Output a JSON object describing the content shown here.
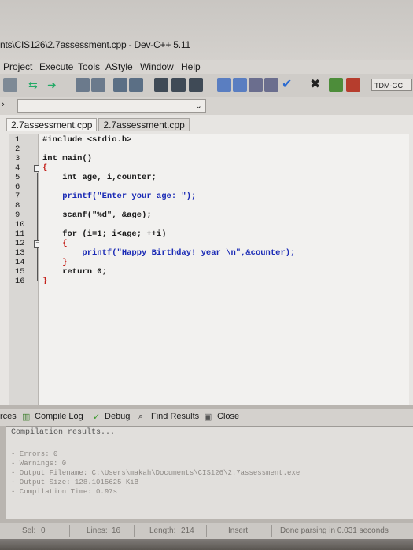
{
  "window": {
    "title": "nts\\CIS126\\2.7assessment.cpp - Dev-C++ 5.11"
  },
  "menubar": {
    "items": [
      "Project",
      "Execute",
      "Tools",
      "AStyle",
      "Window",
      "Help"
    ]
  },
  "toolbar": {
    "compiler_selector": "TDM-GC"
  },
  "editor": {
    "tabs": [
      "2.7assessment.cpp",
      "2.7assessment.cpp"
    ],
    "active_tab": 0,
    "lines": [
      {
        "n": "1",
        "text": "#include <stdio.h>"
      },
      {
        "n": "2",
        "text": ""
      },
      {
        "n": "3",
        "text": "int main()"
      },
      {
        "n": "4",
        "text": "{"
      },
      {
        "n": "5",
        "text": "    int age, i,counter;"
      },
      {
        "n": "6",
        "text": ""
      },
      {
        "n": "7",
        "text": "    printf(\"Enter your age: \");"
      },
      {
        "n": "8",
        "text": ""
      },
      {
        "n": "9",
        "text": "    scanf(\"%d\", &age);"
      },
      {
        "n": "10",
        "text": ""
      },
      {
        "n": "11",
        "text": "    for (i=1; i<age; ++i)"
      },
      {
        "n": "12",
        "text": "    {"
      },
      {
        "n": "13",
        "text": "        printf(\"Happy Birthday! year \\n\",&counter);"
      },
      {
        "n": "14",
        "text": "    }"
      },
      {
        "n": "15",
        "text": "    return 0;"
      },
      {
        "n": "16",
        "text": "}"
      }
    ]
  },
  "bottom_panel": {
    "tabs": [
      "rces",
      "Compile Log",
      "Debug",
      "Find Results",
      "Close"
    ],
    "results_header": "Compilation results...",
    "results": [
      "- Errors: 0",
      "- Warnings: 0",
      "- Output Filename: C:\\Users\\makah\\Documents\\CIS126\\2.7assessment.exe",
      "- Output Size: 128.1015625 KiB",
      "- Compilation Time: 0.97s"
    ]
  },
  "statusbar": {
    "sel_label": "Sel:",
    "sel_value": "0",
    "lines_label": "Lines:",
    "lines_value": "16",
    "length_label": "Length:",
    "length_value": "214",
    "mode": "Insert",
    "message": "Done parsing in 0.031 seconds"
  },
  "colors": {
    "keyword_string": "#1a2ab5",
    "brace": "#c4201a",
    "editor_bg": "#f2f1ef"
  }
}
